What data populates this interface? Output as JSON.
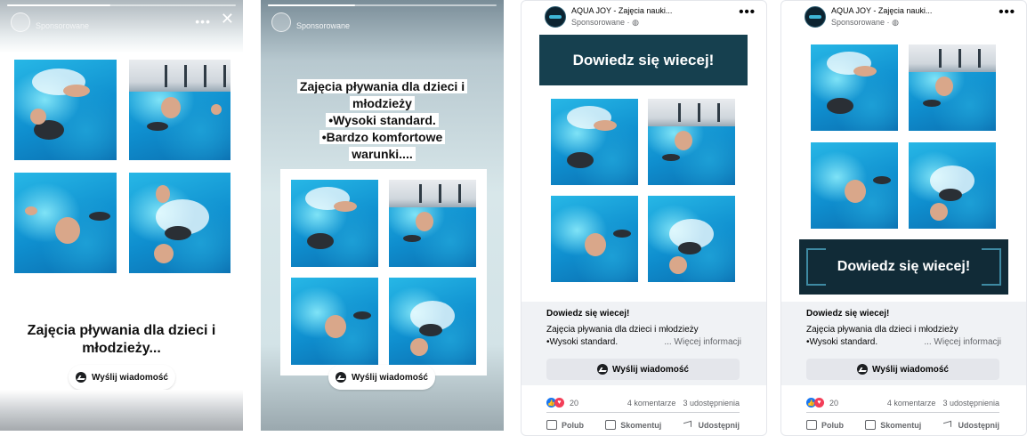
{
  "story1": {
    "sponsored_label": "Sponsorowane",
    "more_icon": "more-horizontal-icon",
    "close_icon": "close-icon",
    "caption": "Zajęcia pływania dla dzieci i młodzieży...",
    "cta_label": "Wyślij wiadomość",
    "progress_fraction": 0.45
  },
  "story2": {
    "sponsored_label": "Sponsorowane",
    "text_lines": [
      "Zajęcia pływania dla dzieci i młodzieży",
      "•Wysoki standard.",
      "•Bardzo komfortowe warunki...."
    ],
    "cta_label": "Wyślij wiadomość",
    "progress_fraction": 0.38
  },
  "feed1": {
    "page_name": "AQUA JOY - Zajęcia nauki...",
    "sponsored_label": "Sponsorowane ·",
    "banner_text": "Dowiedz się wiecej!",
    "link_title": "Dowiedz się wiecej!",
    "link_desc_line1": "Zajęcia pływania dla dzieci i młodzieży",
    "link_desc_line2": "•Wysoki standard.",
    "link_more": "... Więcej informacji",
    "cta_label": "Wyślij wiadomość",
    "reaction_count": "20",
    "comments": "4 komentarze",
    "shares": "3 udostępnienia",
    "like_label": "Polub",
    "comment_label": "Skomentuj",
    "share_label": "Udostępnij"
  },
  "feed2": {
    "page_name": "AQUA JOY - Zajęcia nauki...",
    "sponsored_label": "Sponsorowane ·",
    "banner_text": "Dowiedz się wiecej!",
    "link_title": "Dowiedz się wiecej!",
    "link_desc_line1": "Zajęcia pływania dla dzieci i młodzieży",
    "link_desc_line2": "•Wysoki standard.",
    "link_more": "... Więcej informacji",
    "cta_label": "Wyślij wiadomość",
    "reaction_count": "20",
    "comments": "4 komentarze",
    "shares": "3 udostępnienia",
    "like_label": "Polub",
    "comment_label": "Skomentuj",
    "share_label": "Udostępnij"
  },
  "colors": {
    "banner": "#16404f",
    "banner_dark": "#112b37",
    "pool": "#1aa3dc",
    "facebook_blue": "#1877f2"
  }
}
